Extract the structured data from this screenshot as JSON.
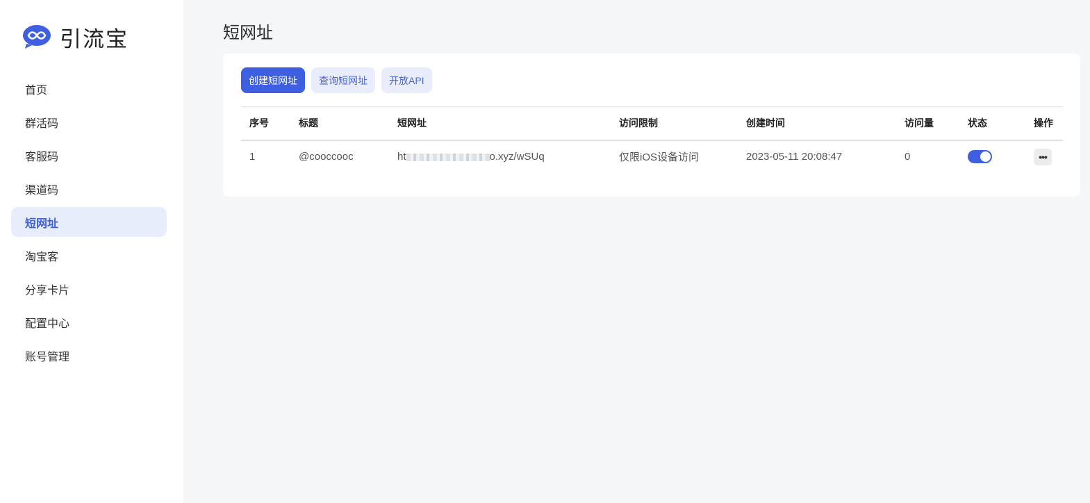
{
  "brand": {
    "name": "引流宝",
    "logo_icon": "chat-bubble-infinity-icon",
    "accent": "#3d5fe0"
  },
  "sidebar": {
    "items": [
      {
        "label": "首页",
        "active": false
      },
      {
        "label": "群活码",
        "active": false
      },
      {
        "label": "客服码",
        "active": false
      },
      {
        "label": "渠道码",
        "active": false
      },
      {
        "label": "短网址",
        "active": true
      },
      {
        "label": "淘宝客",
        "active": false
      },
      {
        "label": "分享卡片",
        "active": false
      },
      {
        "label": "配置中心",
        "active": false
      },
      {
        "label": "账号管理",
        "active": false
      }
    ]
  },
  "page": {
    "title": "短网址"
  },
  "toolbar": {
    "create_label": "创建短网址",
    "query_label": "查询短网址",
    "api_label": "开放API"
  },
  "table": {
    "headers": {
      "seq": "序号",
      "title": "标题",
      "url": "短网址",
      "limit": "访问限制",
      "created": "创建时间",
      "visits": "访问量",
      "status": "状态",
      "actions": "操作"
    },
    "rows": [
      {
        "seq": "1",
        "title": "@cooccooc",
        "url_prefix": "ht",
        "url_suffix": "o.xyz/wSUq",
        "limit": "仅限iOS设备访问",
        "created": "2023-05-11 20:08:47",
        "visits": "0",
        "status_on": true,
        "more_icon": "more-dots-icon"
      }
    ]
  }
}
